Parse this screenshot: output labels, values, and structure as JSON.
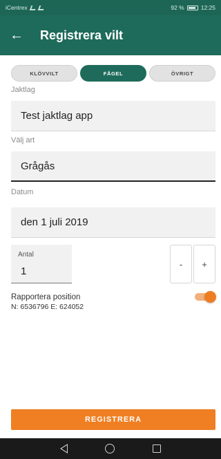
{
  "status_bar": {
    "carrier": "iCentrex",
    "battery_text": "92 %",
    "time": "12:25",
    "colors": {
      "background": "#1d6656"
    }
  },
  "app_bar": {
    "back_icon": "arrow-left-icon",
    "title": "Registrera vilt",
    "colors": {
      "background": "#1e6b5b"
    }
  },
  "segments": {
    "items": [
      {
        "label": "KLÖVVILT",
        "active": false
      },
      {
        "label": "FÅGEL",
        "active": true
      },
      {
        "label": "ÖVRIGT",
        "active": false
      }
    ]
  },
  "form": {
    "jaktlag": {
      "label": "Jaktlag",
      "value": "Test jaktlag app"
    },
    "art": {
      "label": "Välj art",
      "value": "Grågås"
    },
    "datum": {
      "label": "Datum",
      "value": "den 1 juli 2019"
    },
    "antal": {
      "label": "Antal",
      "value": "1"
    },
    "stepper": {
      "minus": "-",
      "plus": "+"
    },
    "position": {
      "label": "Rapportera position",
      "coords": "N: 6536796  E: 624052",
      "enabled": true
    }
  },
  "submit": {
    "label": "REGISTRERA",
    "color": "#ef7f22"
  },
  "nav": {
    "icons": [
      "nav-back-icon",
      "nav-home-icon",
      "nav-recents-icon"
    ]
  }
}
